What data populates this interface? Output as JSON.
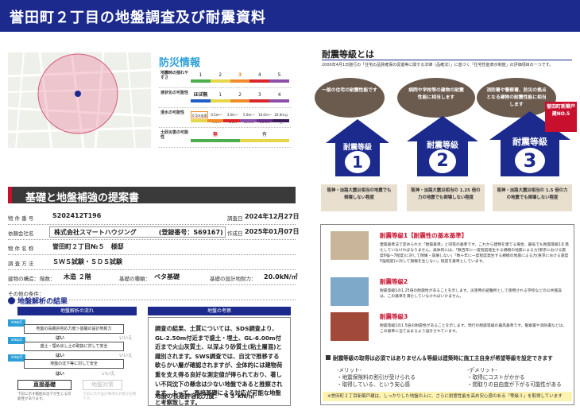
{
  "header": {
    "title": "誉田町２丁目の地盤調査及び耐震資料"
  },
  "bousai": {
    "title": "防災情報",
    "rows": [
      {
        "label": "地震時の揺れやすさ",
        "nums": [
          "1",
          "2",
          "3",
          "4",
          "5"
        ]
      },
      {
        "label": "液状化の可能性",
        "nums": [
          "ほぼ無",
          "1",
          "2",
          "3",
          "4"
        ]
      },
      {
        "label": "浸水の可能性",
        "nums": [
          "0.5m未満",
          "0.5m〜3.0m",
          "3.0m〜5.0m",
          "5.0m〜10.0m",
          "10.0m〜20.0m",
          "20.0m以上"
        ]
      },
      {
        "label": "土砂災害の可能性",
        "nums": [
          "無",
          "有"
        ]
      }
    ],
    "colors": {
      "green": "#4cae4c",
      "yellow": "#e6d64a",
      "orange": "#f08a2a",
      "red": "#d9262b",
      "purple": "#8a4fa8",
      "blue": "#1e5cc6"
    }
  },
  "kiso": {
    "title": "基礎と地盤補強の提案書"
  },
  "info": {
    "bukken_no_label": "物 件 番 号",
    "bukken_no": "S202412T196",
    "chousa_label": "調査日",
    "chousa": "2024年12月27日",
    "irai_label": "依頼会社名",
    "irai": "株式会社スマートハウジング",
    "touroku": "(登録番号：S69167)",
    "sakusei_label": "作成日",
    "sakusei": "2025年01月07日",
    "bukken_name_label": "物 件 名 称",
    "bukken_name": "誉田町２丁目№５　様邸",
    "houhou_label": "調 査 方 法",
    "houhou": "ＳＷＳ試験・ＳＤＳ試験",
    "kouzou_label": "建物の構造：",
    "kaisu_label": "階数：",
    "kaisu": "木造 ２階",
    "kisokeishiki_label": "基礎の種類：",
    "kisokeishiki": "ベタ基礎",
    "sekkei_label": "基礎の設計地耐力：",
    "sekkei": "20.0kN/㎡",
    "other_label": "その他の条件："
  },
  "kaiseki": {
    "title": "地盤解析の結果",
    "flow_header": "地盤解析の流れ",
    "exam_header": "地盤の考察",
    "steps": [
      "step1",
      "step2",
      "step3"
    ],
    "boxes": [
      "地盤の長期許容応力度＞基礎の設計地耐力",
      "盛土・埋め戻し土の取扱に対して安全",
      "地盤の沈下等に対して安全"
    ],
    "yes": "はい",
    "no": "いいえ",
    "result1": "直接基礎",
    "result2": "地盤対策",
    "note1": "下記に示す範囲の沈下が生じる可能性があります。",
    "note2": "下記に示す設計事項の対策が必要です。",
    "exam_text": "調査の結果、土質については、SDS調査より、GL-2.50m付近まで盛土・埋土、GL-6.00m付近まで火山灰質土、以深より砂質土(粘土層混)と識別されます。SWS調査では、自沈で推移する軟らかい層が確認されますが、全体的には建物荷重を支え得る良好な測定値が得られており、著しい不同沈下の懸念は少ない地盤であると推察されます。よって、直接基礎による対応が可能な地盤と考察致します。",
    "exam_foot": "地盤の長期許容応力度：　４３ kN/㎡"
  },
  "taishin": {
    "title": "耐震等級とは",
    "desc": "2000年4月1日施行の「住宅の品質確保の促進等に関する法律（品確法）」に基づく「住宅性能表示制度」の評価項目の一つです。",
    "bubbles": [
      "一般の住宅の耐震性能です",
      "病院や学校等の建物の耐震性能に相当します",
      "消防署や警察署、防災の拠点となる建物の耐震性能に相当します"
    ],
    "house_label": "耐震等級",
    "grades": [
      "1",
      "2",
      "3"
    ],
    "badge": "誉田町新築戸建NO.5",
    "descs": [
      "阪神・淡路大震災相当の地震でも倒壊しない程度",
      "阪神・淡路大震災相当の 1.25 倍の力の地震でも倒壊しない程度",
      "阪神・淡路大震災相当の 1.5 倍の力の地震でも倒壊しない程度"
    ]
  },
  "levels": [
    {
      "title": "耐震等級1【耐震性の基本基準】",
      "text": "建築基準法で定められた「耐震基準」と同等の基準です。これから建物を建てる場合、最低でも耐震等級1を満たしていなければなりません。具体的には、「数百年に一度程度発生する規模の地震による力(東京における震度6強〜7程度)に対して倒壊・崩壊しない」「数十年に一度程度発生する規模の地震による力(東京における震度5強程度)に対して損傷を生じない」程度を基準としています。"
    },
    {
      "title": "耐震等級2",
      "text": "耐震等級1の1.25倍の耐震性があることを示します。災害時の避難所として使用される学校などの公共施設は、この基準を満たしていなければいけません。"
    },
    {
      "title": "耐震等級3",
      "text": "耐震等級1の1.5倍の耐震性があることを示します。現行の耐震等級の最高基準です。警察署や消防署などは、この基準に当てはまるよう設計されています。"
    }
  ],
  "merit": {
    "headline": "耐震等級の取得は必須ではありません＆等級は建築時に施工主自身が希望等級を設定できます",
    "merit_label": "-メリット-",
    "merit1": "・地震保険料の割引が受けられる",
    "merit2": "・取得している、という安心感",
    "demerit_label": "-デメリット-",
    "demerit1": "・取得にコストがかかる",
    "demerit2": "・間取りの自由度が下がる可能性がある",
    "note": "※誉田町２丁目新築戸建は、しっかりした地盤の上に、さらに耐震性能を高め安心感のある「等級３」を取得しています"
  }
}
